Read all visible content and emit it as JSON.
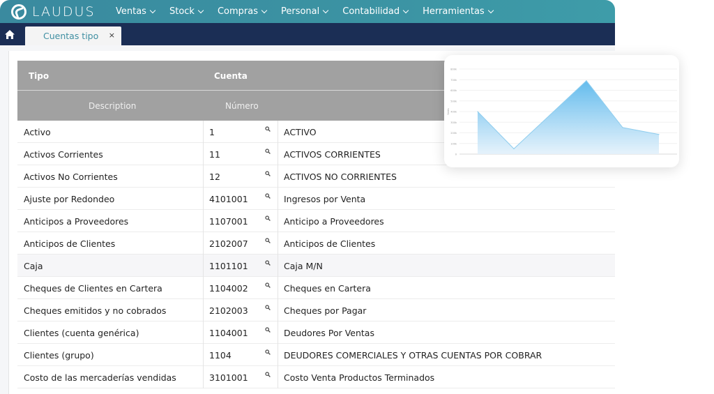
{
  "brand": {
    "name": "LAUDUS"
  },
  "menu": [
    "Ventas",
    "Stock",
    "Compras",
    "Personal",
    "Contabilidad",
    "Herramientas"
  ],
  "tabs": [
    {
      "label": "Cuentas tipo",
      "close": "×"
    }
  ],
  "table": {
    "headers": {
      "tipo": "Tipo",
      "cuenta": "Cuenta",
      "description": "Description",
      "numero": "Número"
    },
    "rows": [
      {
        "tipo": "Activo",
        "numero": "1",
        "descripcion": "ACTIVO"
      },
      {
        "tipo": "Activos Corrientes",
        "numero": "11",
        "descripcion": "ACTIVOS CORRIENTES"
      },
      {
        "tipo": "Activos No Corrientes",
        "numero": "12",
        "descripcion": "ACTIVOS NO CORRIENTES"
      },
      {
        "tipo": "Ajuste por Redondeo",
        "numero": "4101001",
        "descripcion": "Ingresos por Venta"
      },
      {
        "tipo": "Anticipos a Proveedores",
        "numero": "1107001",
        "descripcion": "Anticipo a Proveedores"
      },
      {
        "tipo": "Anticipos de Clientes",
        "numero": "2102007",
        "descripcion": "Anticipos de Clientes"
      },
      {
        "tipo": "Caja",
        "numero": "1101101",
        "descripcion": "Caja M/N"
      },
      {
        "tipo": "Cheques de Clientes en Cartera",
        "numero": "1104002",
        "descripcion": "Cheques en Cartera"
      },
      {
        "tipo": "Cheques emitidos y no cobrados",
        "numero": "2102003",
        "descripcion": "Cheques por Pagar"
      },
      {
        "tipo": "Clientes (cuenta genérica)",
        "numero": "1104001",
        "descripcion": "Deudores Por Ventas"
      },
      {
        "tipo": "Clientes (grupo)",
        "numero": "1104",
        "descripcion": "DEUDORES COMERCIALES Y OTRAS CUENTAS POR COBRAR"
      },
      {
        "tipo": "Costo de las mercaderías vendidas",
        "numero": "3101001",
        "descripcion": "Costo Venta Productos Terminados"
      }
    ],
    "highlighted_row": 6
  },
  "colors": {
    "nav": "#3a8a9f",
    "tabbar": "#1b2e55",
    "accent": "#3f8fa2",
    "header": "#a1a1a1",
    "area": "#5bb8ec"
  },
  "chart_data": {
    "type": "area",
    "x": [
      0,
      1,
      2,
      3,
      4,
      5
    ],
    "values": [
      400,
      50,
      370,
      690,
      250,
      185
    ],
    "ylim": [
      0,
      800
    ],
    "yticks": [
      "0",
      "100k",
      "200k",
      "300k",
      "400k",
      "500k",
      "600k",
      "700k",
      "800k"
    ],
    "ylabel": "Sales",
    "grid": true
  }
}
